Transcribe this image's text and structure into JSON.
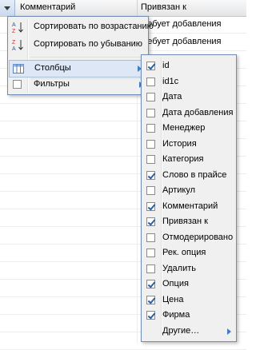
{
  "header": {
    "columns": [
      {
        "label": "Комментарий"
      },
      {
        "label": "Привязан к"
      }
    ]
  },
  "rows": [
    {
      "linked": "Требует добавления"
    },
    {
      "linked": "Требует добавления"
    }
  ],
  "column_menu": {
    "items": [
      {
        "label": "Сортировать по возрастанию",
        "icon": "sort-ascending-icon"
      },
      {
        "label": "Сортировать по убыванию",
        "icon": "sort-descending-icon"
      },
      {
        "label": "Столбцы",
        "icon": "columns-icon",
        "has_submenu": true
      },
      {
        "label": "Фильтры",
        "checked": false,
        "has_submenu": true
      }
    ]
  },
  "columns_submenu": {
    "items": [
      {
        "label": "id",
        "checked": true
      },
      {
        "label": "id1c",
        "checked": false
      },
      {
        "label": "Дата",
        "checked": false
      },
      {
        "label": "Дата добавления",
        "checked": false
      },
      {
        "label": "Менеджер",
        "checked": false
      },
      {
        "label": "История",
        "checked": false
      },
      {
        "label": "Категория",
        "checked": false
      },
      {
        "label": "Слово в прайсе",
        "checked": true
      },
      {
        "label": "Артикул",
        "checked": false
      },
      {
        "label": "Комментарий",
        "checked": true
      },
      {
        "label": "Привязан к",
        "checked": true
      },
      {
        "label": "Отмодерировано",
        "checked": false
      },
      {
        "label": "Рек. опция",
        "checked": false
      },
      {
        "label": "Удалить",
        "checked": false
      },
      {
        "label": "Опция",
        "checked": true
      },
      {
        "label": "Цена",
        "checked": true
      },
      {
        "label": "Фирма",
        "checked": true
      }
    ],
    "more_label": "Другие…"
  }
}
